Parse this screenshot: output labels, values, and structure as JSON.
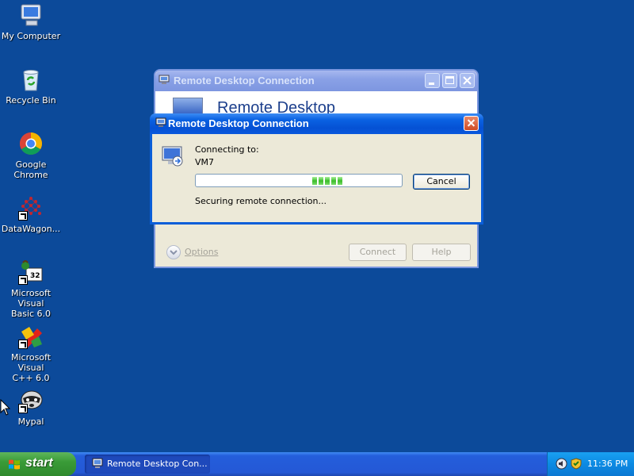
{
  "desktop": {
    "icons": [
      {
        "label": "My Computer",
        "icon": "my-computer-icon"
      },
      {
        "label": "Recycle Bin",
        "icon": "recycle-bin-icon"
      },
      {
        "label": "Google Chrome",
        "icon": "chrome-icon"
      },
      {
        "label": "DataWagon...",
        "icon": "datawagon-icon"
      },
      {
        "label_line1": "Microsoft Visual",
        "label_line2": "Basic 6.0",
        "icon": "vb6-icon"
      },
      {
        "label_line1": "Microsoft Visual",
        "label_line2": "C++ 6.0",
        "icon": "vcpp-icon"
      },
      {
        "label": "Mypal",
        "icon": "mypal-icon"
      }
    ]
  },
  "background_window": {
    "title": "Remote Desktop Connection",
    "banner_title": "Remote Desktop",
    "options_label": "Options",
    "connect_label": "Connect",
    "help_label": "Help"
  },
  "dialog": {
    "title": "Remote Desktop Connection",
    "connecting_label": "Connecting to:",
    "computer_name": "VM7",
    "status_text": "Securing remote connection...",
    "cancel_label": "Cancel",
    "progress_segments": 5
  },
  "taskbar": {
    "start_label": "start",
    "task_label": "Remote Desktop Con...",
    "clock": "11:36 PM"
  },
  "colors": {
    "desktop_bg": "#0c4a9a",
    "title_active": "#0551d4",
    "progress_green": "#3bbd2a"
  }
}
